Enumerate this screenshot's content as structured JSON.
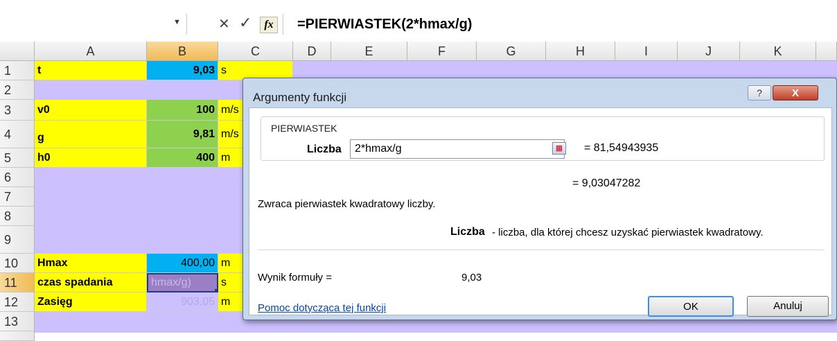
{
  "formula_bar": {
    "dropdown_icon": "▼",
    "cancel_icon": "✕",
    "enter_icon": "✓",
    "fx_label": "fx",
    "formula": "=PIERWIASTEK(2*hmax/g)"
  },
  "columns": [
    "A",
    "B",
    "C",
    "D",
    "E",
    "F",
    "G",
    "H",
    "I",
    "J",
    "K"
  ],
  "rows": [
    "1",
    "2",
    "3",
    "4",
    "5",
    "6",
    "7",
    "8",
    "9",
    "10",
    "11",
    "12",
    "13"
  ],
  "cells": {
    "a1": "t",
    "b1": "9,03",
    "c1": "s",
    "a3": "v0",
    "b3": "100",
    "c3": "m/s",
    "a4": "g",
    "b4": "9,81",
    "c4": "m/s",
    "a5": "h0",
    "b5": "400",
    "c5": "m",
    "a10": "Hmax",
    "b10": "400,00",
    "c10": "m",
    "a11": "czas spadania",
    "b11": "hmax/g)",
    "c11": "s",
    "a12": "Zasięg",
    "b12": "903,05",
    "c12": "m"
  },
  "dialog": {
    "title": "Argumenty funkcji",
    "help_icon": "?",
    "close_icon": "X",
    "function_name": "PIERWIASTEK",
    "arg_label": "Liczba",
    "arg_value": "2*hmax/g",
    "arg_result": "=  81,54943935",
    "function_result": "=  9,03047282",
    "description": "Zwraca pierwiastek kwadratowy liczby.",
    "arg_desc_name": "Liczba",
    "arg_desc": "- liczba, dla której chcesz uzyskać pierwiastek kwadratowy.",
    "result_label": "Wynik formuły =",
    "result_value": "9,03",
    "help_link": "Pomoc dotycząca tej funkcji",
    "ok_label": "OK",
    "cancel_label": "Anuluj"
  },
  "colors": {
    "yellow": "#ffff00",
    "green": "#8ed14f",
    "blue": "#00b0f0",
    "lavender": "#ccc0ff"
  }
}
